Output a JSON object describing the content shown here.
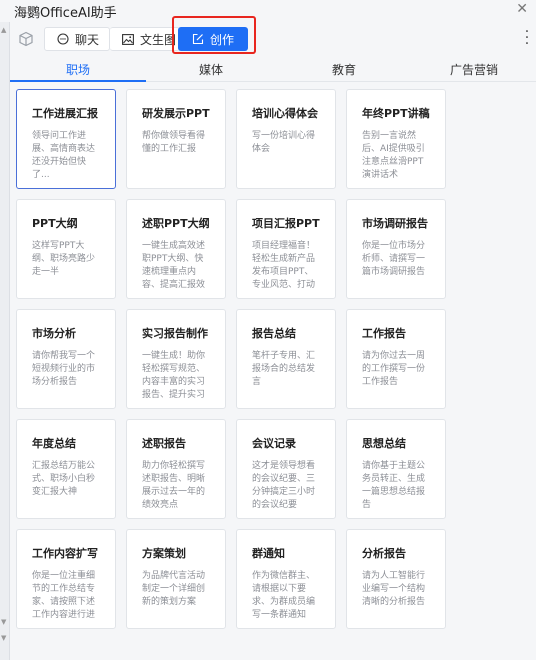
{
  "app": {
    "title": "海鹦OfficeAI助手"
  },
  "modes": {
    "chat": "聊天",
    "image": "文生图",
    "create": "创作"
  },
  "tabs": [
    "职场",
    "媒体",
    "教育",
    "广告营销"
  ],
  "cards": [
    {
      "title": "工作进展汇报",
      "desc": "领导问工作进展、高情商表达还没开始但快了..."
    },
    {
      "title": "研发展示PPT",
      "desc": "帮你做领导看得懂的工作汇报"
    },
    {
      "title": "培训心得体会",
      "desc": "写一份培训心得体会"
    },
    {
      "title": "年终PPT讲稿",
      "desc": "告别一言说然后、AI提供吸引注意点丝滑PPT演讲话术"
    },
    {
      "title": "PPT大纲",
      "desc": "这样写PPT大纲、职场亮路少走一半"
    },
    {
      "title": "述职PPT大纲",
      "desc": "一键生成高效述职PPT大纲、快速梳理重点内容、提高汇报效"
    },
    {
      "title": "项目汇报PPT",
      "desc": "项目经理福音！轻松生成新产品发布项目PPT、专业风范、打动"
    },
    {
      "title": "市场调研报告",
      "desc": "你是一位市场分析师、请撰写一篇市场调研报告"
    },
    {
      "title": "市场分析",
      "desc": "请你帮我写一个短视频行业的市场分析报告"
    },
    {
      "title": "实习报告制作",
      "desc": "一键生成！助你轻松撰写规范、内容丰富的实习报告、提升实习"
    },
    {
      "title": "报告总结",
      "desc": "笔杆子专用、汇报场合的总结发言"
    },
    {
      "title": "工作报告",
      "desc": "请为你过去一周的工作撰写一份工作报告"
    },
    {
      "title": "年度总结",
      "desc": "汇报总结万能公式、职场小白秒变汇报大神"
    },
    {
      "title": "述职报告",
      "desc": "助力你轻松撰写述职报告、明晰展示过去一年的绩效亮点"
    },
    {
      "title": "会议记录",
      "desc": "这才是领导想看的会议纪要、三分钟搞定三小时的会议纪要"
    },
    {
      "title": "思想总结",
      "desc": "请你基于主题公务员转正、生成一篇思想总结报告"
    },
    {
      "title": "工作内容扩写",
      "desc": "你是一位注重细节的工作总结专家、请按照下述工作内容进行进细"
    },
    {
      "title": "方案策划",
      "desc": "为品牌代言活动制定一个详细创新的策划方案"
    },
    {
      "title": "群通知",
      "desc": "作为微信群主、请根据以下要求、为群成员编写一条群通知"
    },
    {
      "title": "分析报告",
      "desc": "请为人工智能行业编写一个结构清晰的分析报告"
    }
  ],
  "colors": {
    "accent": "#1e6ef5",
    "highlight": "#e8261f"
  }
}
